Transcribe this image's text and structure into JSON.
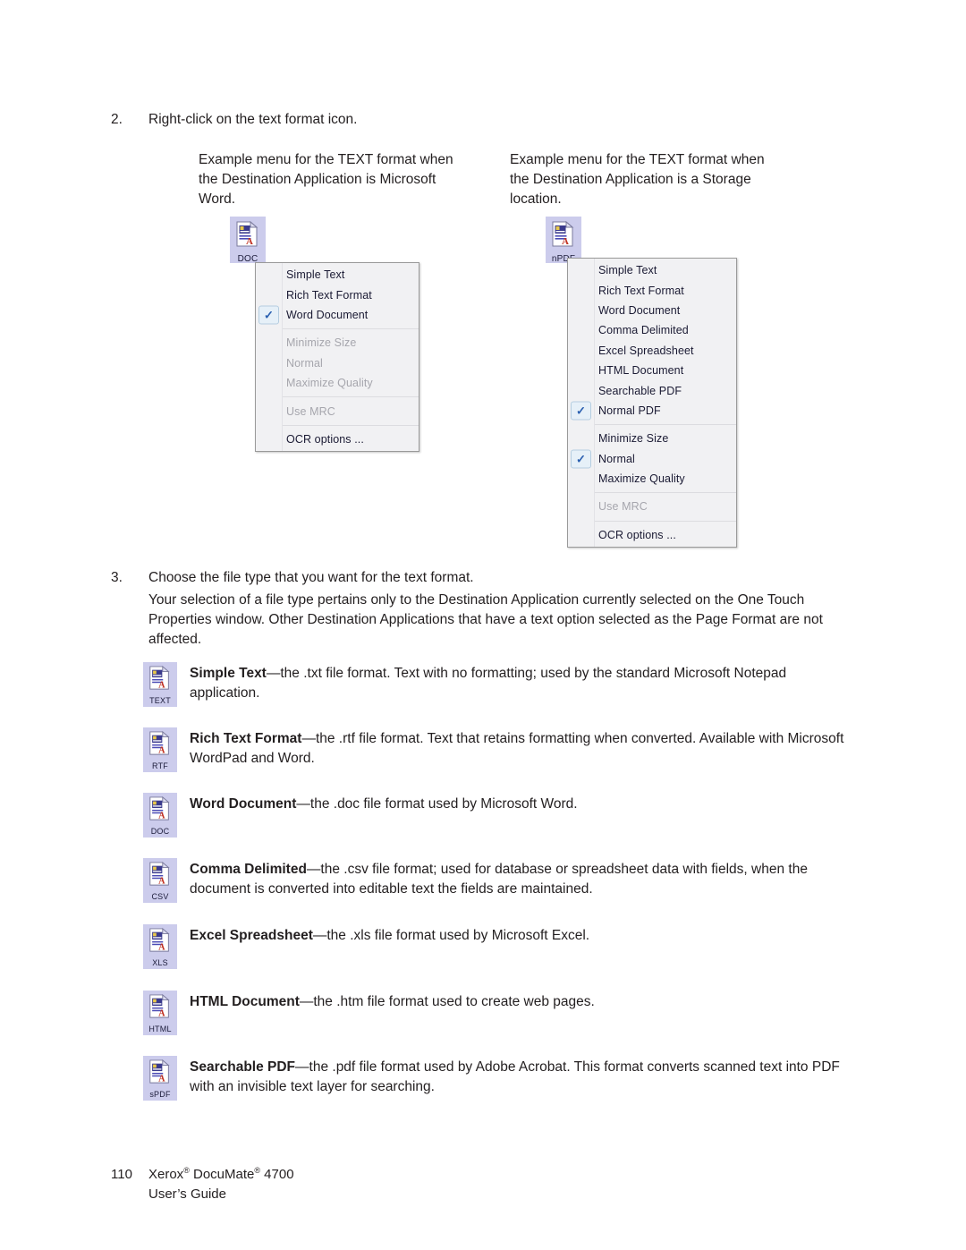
{
  "steps": [
    {
      "num": "2.",
      "text": "Right-click on the text format icon."
    },
    {
      "num": "3.",
      "text": "Choose the file type that you want for the text format."
    }
  ],
  "step3_paragraph": "Your selection of a file type pertains only to the Destination Application currently selected on the One Touch Properties window. Other Destination Applications that have a text option selected as the Page Format are not affected.",
  "captions": {
    "left": "Example menu for the TEXT format when the Destination Application is Microsoft Word.",
    "right": "Example menu for the TEXT format when the Destination Application is a Storage location."
  },
  "menus": {
    "word": {
      "icon_label": "DOC",
      "items": [
        {
          "label": "Simple Text",
          "checked": false,
          "disabled": false,
          "separator_after": false
        },
        {
          "label": "Rich Text Format",
          "checked": false,
          "disabled": false,
          "separator_after": false
        },
        {
          "label": "Word Document",
          "checked": true,
          "disabled": false,
          "separator_after": true
        },
        {
          "label": "Minimize Size",
          "checked": false,
          "disabled": true,
          "separator_after": false
        },
        {
          "label": "Normal",
          "checked": false,
          "disabled": true,
          "separator_after": false
        },
        {
          "label": "Maximize Quality",
          "checked": false,
          "disabled": true,
          "separator_after": true
        },
        {
          "label": "Use MRC",
          "checked": false,
          "disabled": true,
          "separator_after": true
        },
        {
          "label": "OCR options ...",
          "checked": false,
          "disabled": false,
          "separator_after": false
        }
      ]
    },
    "storage": {
      "icon_label": "nPDF",
      "items": [
        {
          "label": "Simple Text",
          "checked": false,
          "disabled": false,
          "separator_after": false
        },
        {
          "label": "Rich Text Format",
          "checked": false,
          "disabled": false,
          "separator_after": false
        },
        {
          "label": "Word Document",
          "checked": false,
          "disabled": false,
          "separator_after": false
        },
        {
          "label": "Comma Delimited",
          "checked": false,
          "disabled": false,
          "separator_after": false
        },
        {
          "label": "Excel Spreadsheet",
          "checked": false,
          "disabled": false,
          "separator_after": false
        },
        {
          "label": "HTML Document",
          "checked": false,
          "disabled": false,
          "separator_after": false
        },
        {
          "label": "Searchable PDF",
          "checked": false,
          "disabled": false,
          "separator_after": false
        },
        {
          "label": "Normal PDF",
          "checked": true,
          "disabled": false,
          "separator_after": true
        },
        {
          "label": "Minimize Size",
          "checked": false,
          "disabled": false,
          "separator_after": false
        },
        {
          "label": "Normal",
          "checked": true,
          "disabled": false,
          "separator_after": false
        },
        {
          "label": "Maximize Quality",
          "checked": false,
          "disabled": false,
          "separator_after": true
        },
        {
          "label": "Use MRC",
          "checked": false,
          "disabled": true,
          "separator_after": true
        },
        {
          "label": "OCR options ...",
          "checked": false,
          "disabled": false,
          "separator_after": false
        }
      ]
    }
  },
  "formats": [
    {
      "icon_label": "TEXT",
      "term": "Simple Text",
      "description": "—the .txt file format. Text with no formatting; used by the standard Microsoft Notepad application."
    },
    {
      "icon_label": "RTF",
      "term": "Rich Text Format",
      "description": "—the .rtf file format. Text that retains formatting when converted. Available with Microsoft WordPad and Word."
    },
    {
      "icon_label": "DOC",
      "term": "Word Document",
      "description": "—the .doc file format used by Microsoft Word."
    },
    {
      "icon_label": "CSV",
      "term": "Comma Delimited",
      "description": "—the .csv file format; used for database or spreadsheet data with fields, when the document is converted into editable text the fields are maintained."
    },
    {
      "icon_label": "XLS",
      "term": "Excel Spreadsheet",
      "description": "—the .xls file format used by Microsoft Excel."
    },
    {
      "icon_label": "HTML",
      "term": "HTML Document",
      "description": "—the .htm file format used to create web pages."
    },
    {
      "icon_label": "sPDF",
      "term": "Searchable PDF",
      "description": "—the .pdf file format used by Adobe Acrobat. This format converts scanned text into PDF with an invisible text layer for searching."
    }
  ],
  "footer": {
    "page_number": "110",
    "product_line_1_a": "Xerox",
    "product_line_1_b": " DocuMate",
    "product_line_1_c": " 4700",
    "registered_mark": "®",
    "product_line_2": "User’s Guide"
  },
  "colors": {
    "icon_background": "#ccccec",
    "menu_background": "#f1f1f3",
    "menu_border": "#9a9a9a",
    "check_accent": "#2a5fb0",
    "text": "#231f20",
    "disabled_text": "#a6a6ad"
  }
}
